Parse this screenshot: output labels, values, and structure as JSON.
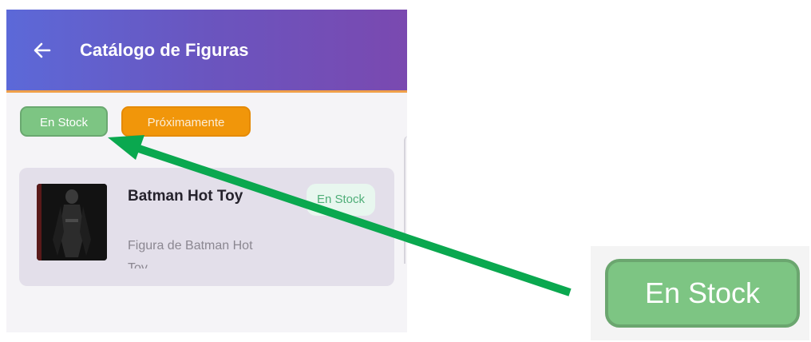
{
  "appbar": {
    "title": "Catálogo de Figuras",
    "back_icon": "arrow-left-icon",
    "gradient": [
      "#5c69d8",
      "#7a49b0"
    ],
    "accent_line": "#f0a04a"
  },
  "filters": {
    "in_stock_label": "En Stock",
    "coming_soon_label": "Próximamente",
    "in_stock_color": "#7dc583",
    "coming_soon_color": "#f1960a"
  },
  "products": [
    {
      "title": "Batman Hot Toy",
      "description": "Figura de Batman Hot Toy",
      "status": "En Stock",
      "status_color": "#4fae78"
    }
  ],
  "callout": {
    "zoom_label": "En Stock",
    "arrow_color": "#0aa84f"
  }
}
